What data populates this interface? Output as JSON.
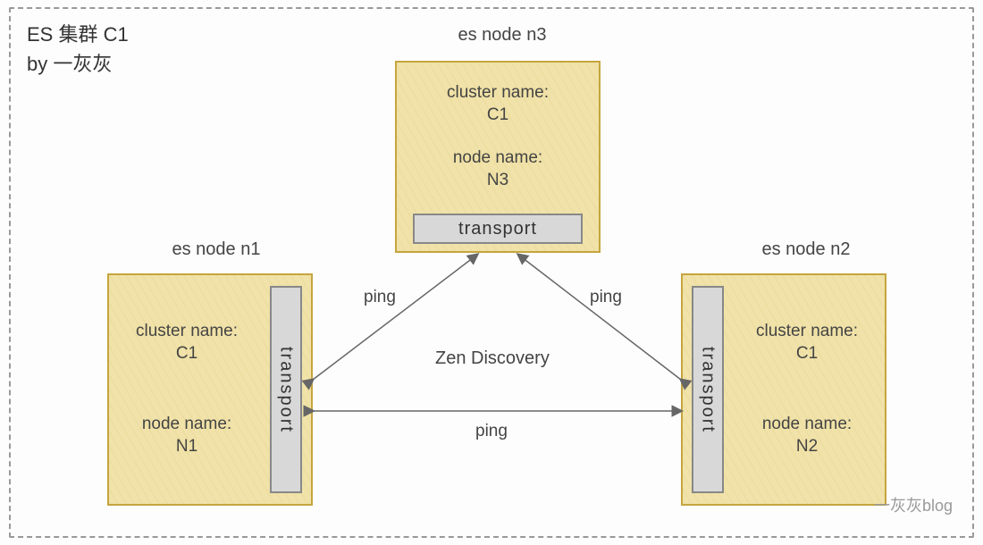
{
  "title": {
    "line1": "ES 集群 C1",
    "line2": "by 一灰灰"
  },
  "nodes": {
    "n3": {
      "label": "es node n3",
      "cluster_label": "cluster name:",
      "cluster_value": "C1",
      "node_label": "node name:",
      "node_value": "N3",
      "transport": "transport"
    },
    "n1": {
      "label": "es node n1",
      "cluster_label": "cluster name:",
      "cluster_value": "C1",
      "node_label": "node name:",
      "node_value": "N1",
      "transport": "transport"
    },
    "n2": {
      "label": "es node n2",
      "cluster_label": "cluster name:",
      "cluster_value": "C1",
      "node_label": "node name:",
      "node_value": "N2",
      "transport": "transport"
    }
  },
  "center": "Zen Discovery",
  "edges": {
    "n1_n3": "ping",
    "n2_n3": "ping",
    "n1_n2": "ping"
  },
  "watermark": "一灰灰blog"
}
